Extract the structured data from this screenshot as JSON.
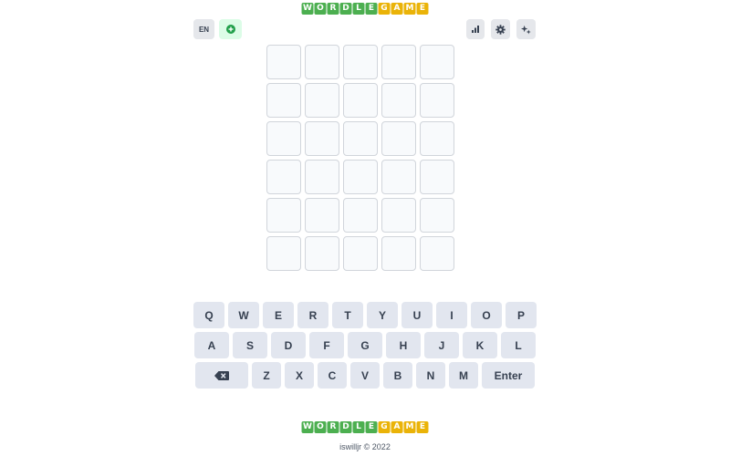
{
  "logo": {
    "letters": [
      {
        "ch": "W",
        "color": "#4caf50"
      },
      {
        "ch": "O",
        "color": "#4caf50"
      },
      {
        "ch": "R",
        "color": "#4caf50"
      },
      {
        "ch": "D",
        "color": "#4caf50"
      },
      {
        "ch": "L",
        "color": "#4caf50"
      },
      {
        "ch": "E",
        "color": "#4caf50"
      },
      {
        "ch": "G",
        "color": "#eab308"
      },
      {
        "ch": "A",
        "color": "#eab308"
      },
      {
        "ch": "M",
        "color": "#eab308"
      },
      {
        "ch": "E",
        "color": "#eab308"
      }
    ]
  },
  "header": {
    "lang_label": "EN",
    "add_icon": "plus-circle-icon",
    "stats_icon": "bar-chart-icon",
    "settings_icon": "gear-icon",
    "info_icon": "sparkle-icon"
  },
  "grid": {
    "rows": 6,
    "cols": 5
  },
  "keyboard": {
    "row1": [
      "Q",
      "W",
      "E",
      "R",
      "T",
      "Y",
      "U",
      "I",
      "O",
      "P"
    ],
    "row2": [
      "A",
      "S",
      "D",
      "F",
      "G",
      "H",
      "J",
      "K",
      "L"
    ],
    "row3": [
      "Z",
      "X",
      "C",
      "V",
      "B",
      "N",
      "M"
    ],
    "backspace_icon": "backspace-icon",
    "enter_label": "Enter"
  },
  "footer": {
    "text": "iswilljr © 2022"
  },
  "colors": {
    "green": "#4caf50",
    "yellow": "#eab308",
    "key_bg": "#e2e6ef"
  }
}
